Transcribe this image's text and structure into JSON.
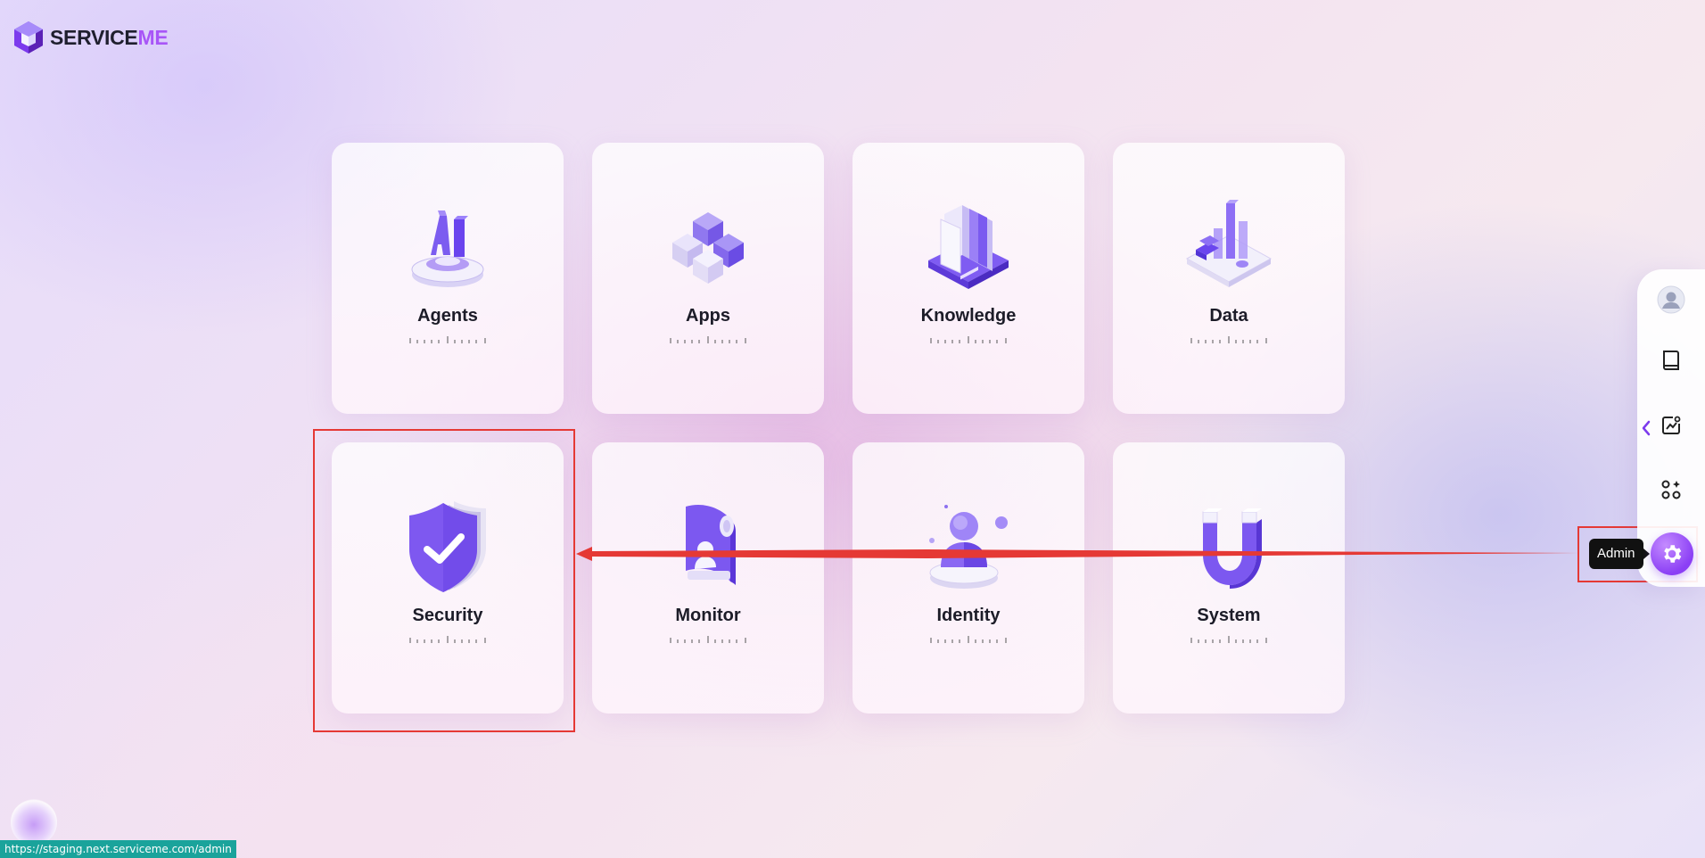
{
  "brand": {
    "name_main": "SERVICE",
    "name_accent": "ME"
  },
  "modules": [
    {
      "label": "Agents",
      "icon": "agents-ai-icon"
    },
    {
      "label": "Apps",
      "icon": "apps-cubes-icon"
    },
    {
      "label": "Knowledge",
      "icon": "knowledge-book-icon"
    },
    {
      "label": "Data",
      "icon": "data-chart-icon"
    },
    {
      "label": "Security",
      "icon": "security-shield-icon"
    },
    {
      "label": "Monitor",
      "icon": "monitor-icon"
    },
    {
      "label": "Identity",
      "icon": "identity-user-icon"
    },
    {
      "label": "System",
      "icon": "system-magnet-icon"
    }
  ],
  "side_nav": {
    "items": [
      "user-avatar-icon",
      "book-icon",
      "analytics-chart-icon",
      "apps-grid-icon",
      "gear-icon"
    ],
    "tooltip": "Admin"
  },
  "status_bar": {
    "url": "https://staging.next.serviceme.com/admin"
  },
  "colors": {
    "accent": "#8b3ff5",
    "highlight": "#e53935"
  }
}
